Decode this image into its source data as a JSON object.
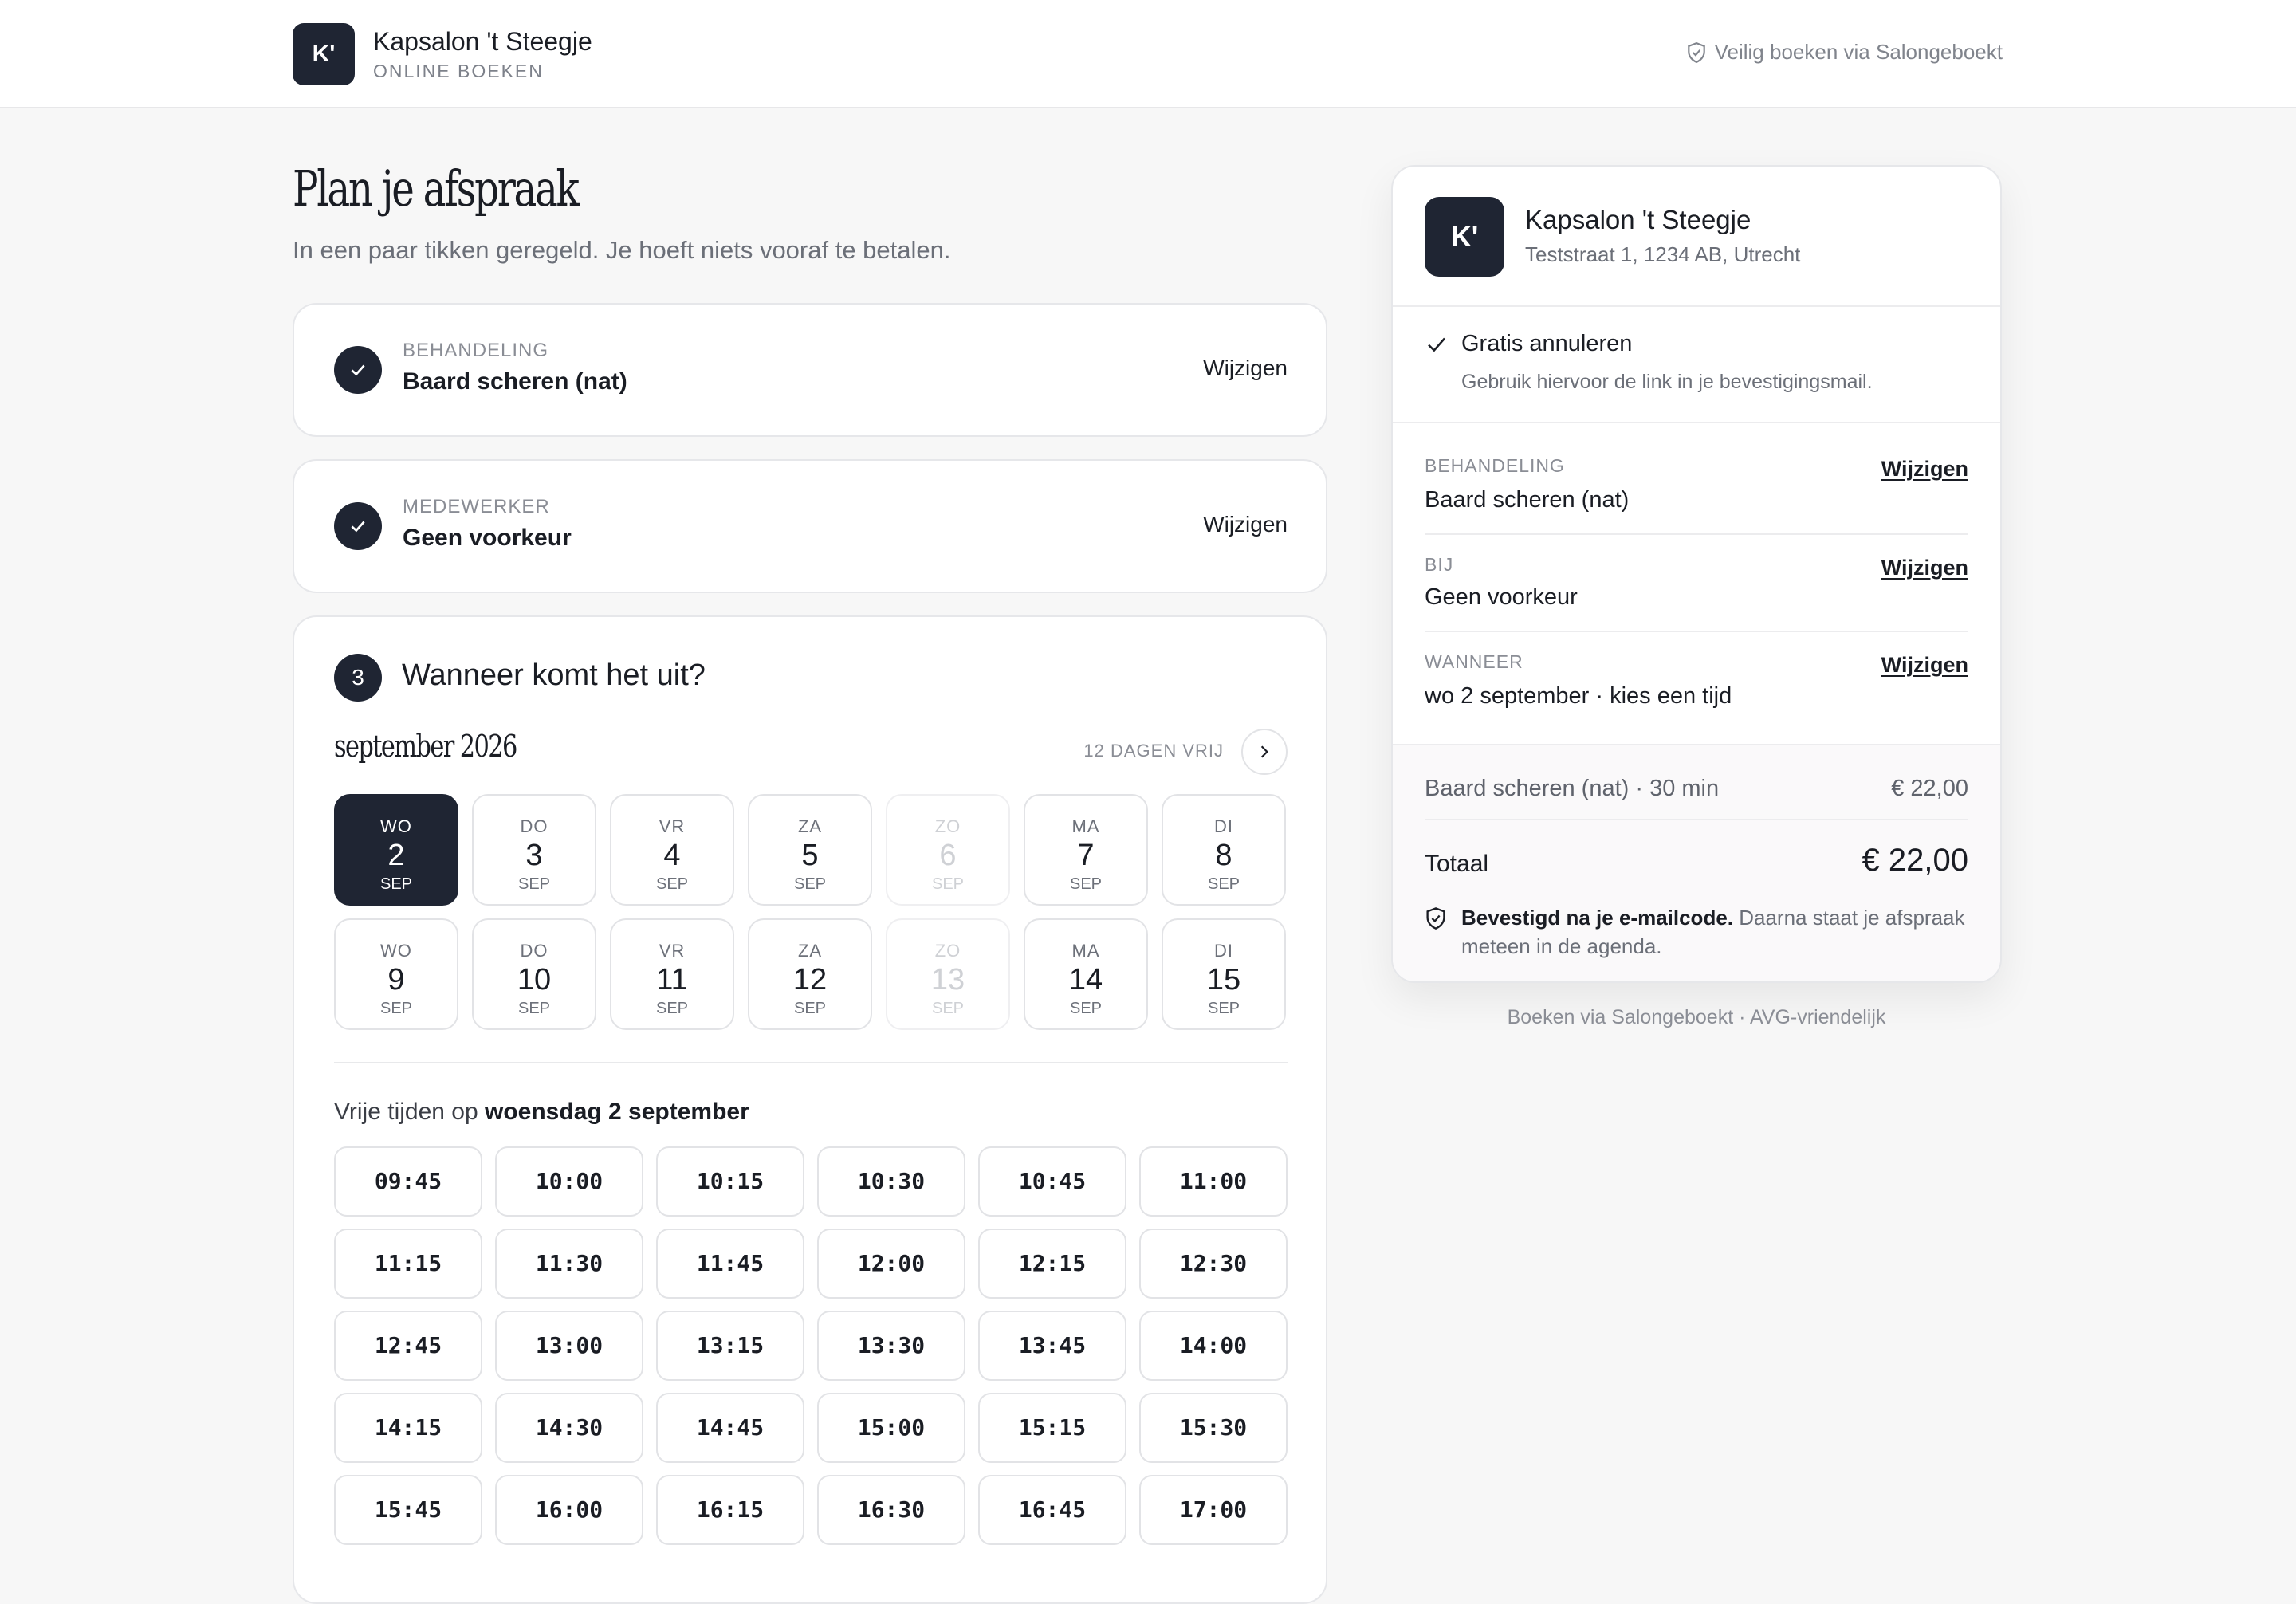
{
  "header": {
    "logo_text": "K'",
    "salon_name": "Kapsalon 't Steegje",
    "subtitle": "ONLINE BOEKEN",
    "secure_text": "Veilig boeken via Salongeboekt"
  },
  "intro": {
    "title": "Plan je afspraak",
    "lead": "In een paar tikken geregeld. Je hoeft niets vooraf te betalen."
  },
  "steps": {
    "treatment": {
      "eyebrow": "BEHANDELING",
      "value": "Baard scheren (nat)",
      "edit": "Wijzigen"
    },
    "employee": {
      "eyebrow": "MEDEWERKER",
      "value": "Geen voorkeur",
      "edit": "Wijzigen"
    },
    "when": {
      "number": "3",
      "title": "Wanneer komt het uit?",
      "month": "september 2026",
      "days_free": "12 DAGEN VRIJ",
      "days": [
        {
          "dow": "WO",
          "num": "2",
          "mon": "SEP",
          "state": "selected"
        },
        {
          "dow": "DO",
          "num": "3",
          "mon": "SEP",
          "state": "available"
        },
        {
          "dow": "VR",
          "num": "4",
          "mon": "SEP",
          "state": "available"
        },
        {
          "dow": "ZA",
          "num": "5",
          "mon": "SEP",
          "state": "available"
        },
        {
          "dow": "ZO",
          "num": "6",
          "mon": "SEP",
          "state": "disabled"
        },
        {
          "dow": "MA",
          "num": "7",
          "mon": "SEP",
          "state": "available"
        },
        {
          "dow": "DI",
          "num": "8",
          "mon": "SEP",
          "state": "available"
        },
        {
          "dow": "WO",
          "num": "9",
          "mon": "SEP",
          "state": "available"
        },
        {
          "dow": "DO",
          "num": "10",
          "mon": "SEP",
          "state": "available"
        },
        {
          "dow": "VR",
          "num": "11",
          "mon": "SEP",
          "state": "available"
        },
        {
          "dow": "ZA",
          "num": "12",
          "mon": "SEP",
          "state": "available"
        },
        {
          "dow": "ZO",
          "num": "13",
          "mon": "SEP",
          "state": "disabled"
        },
        {
          "dow": "MA",
          "num": "14",
          "mon": "SEP",
          "state": "available"
        },
        {
          "dow": "DI",
          "num": "15",
          "mon": "SEP",
          "state": "available"
        }
      ],
      "free_times_prefix": "Vrije tijden op",
      "free_times_day": "woensdag 2 september",
      "slots": [
        "09:45",
        "10:00",
        "10:15",
        "10:30",
        "10:45",
        "11:00",
        "11:15",
        "11:30",
        "11:45",
        "12:00",
        "12:15",
        "12:30",
        "12:45",
        "13:00",
        "13:15",
        "13:30",
        "13:45",
        "14:00",
        "14:15",
        "14:30",
        "14:45",
        "15:00",
        "15:15",
        "15:30",
        "15:45",
        "16:00",
        "16:15",
        "16:30",
        "16:45",
        "17:00"
      ]
    }
  },
  "summary": {
    "logo_text": "K'",
    "salon_name": "Kapsalon 't Steegje",
    "address": "Teststraat 1, 1234 AB, Utrecht",
    "cancel_title": "Gratis annuleren",
    "cancel_text": "Gebruik hiervoor de link in je bevestigingsmail.",
    "rows": [
      {
        "eyebrow": "BEHANDELING",
        "value": "Baard scheren (nat)",
        "link": "Wijzigen"
      },
      {
        "eyebrow": "BIJ",
        "value": "Geen voorkeur",
        "link": "Wijzigen"
      },
      {
        "eyebrow": "WANNEER",
        "value": "wo 2 september · kies een tijd",
        "link": "Wijzigen"
      }
    ],
    "line_item": "Baard scheren (nat) · 30 min",
    "line_price": "€ 22,00",
    "total_label": "Totaal",
    "total": "€ 22,00",
    "note_bold": "Bevestigd na je e-mailcode.",
    "note_rest": " Daarna staat je afspraak meteen in de agenda."
  },
  "footer_note": "Boeken via Salongeboekt · AVG-vriendelijk",
  "colors": {
    "primary": "#1f2533",
    "background": "#f7f7f7"
  }
}
